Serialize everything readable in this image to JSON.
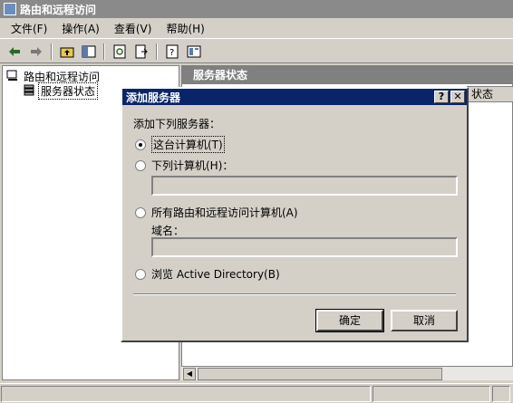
{
  "window": {
    "title": "路由和远程访问"
  },
  "menu": [
    {
      "label": "文件(F)"
    },
    {
      "label": "操作(A)"
    },
    {
      "label": "查看(V)"
    },
    {
      "label": "帮助(H)"
    }
  ],
  "toolbar": {
    "icons": [
      "back-arrow-icon",
      "forward-arrow-icon",
      "up-folder-icon",
      "show-hide-tree-icon",
      "refresh-icon",
      "export-list-icon",
      "help-icon",
      "properties-icon"
    ]
  },
  "tree": {
    "root_label": "路由和远程访问",
    "child_label": "服务器状态"
  },
  "right_pane": {
    "header": "服务器状态",
    "column_header": "状态"
  },
  "dialog": {
    "title": "添加服务器",
    "help_btn": "?",
    "close_btn": "✕",
    "prompt": "添加下列服务器：",
    "options": [
      {
        "label": "这台计算机(T)",
        "checked": true
      },
      {
        "label": "下列计算机(H)：",
        "checked": false
      },
      {
        "label": "所有路由和远程访问计算机(A)",
        "checked": false
      },
      {
        "label": "浏览 Active Directory(B)",
        "checked": false
      }
    ],
    "domain_label": "域名：",
    "computer_value": "",
    "domain_value": "",
    "ok": "确定",
    "cancel": "取消"
  }
}
